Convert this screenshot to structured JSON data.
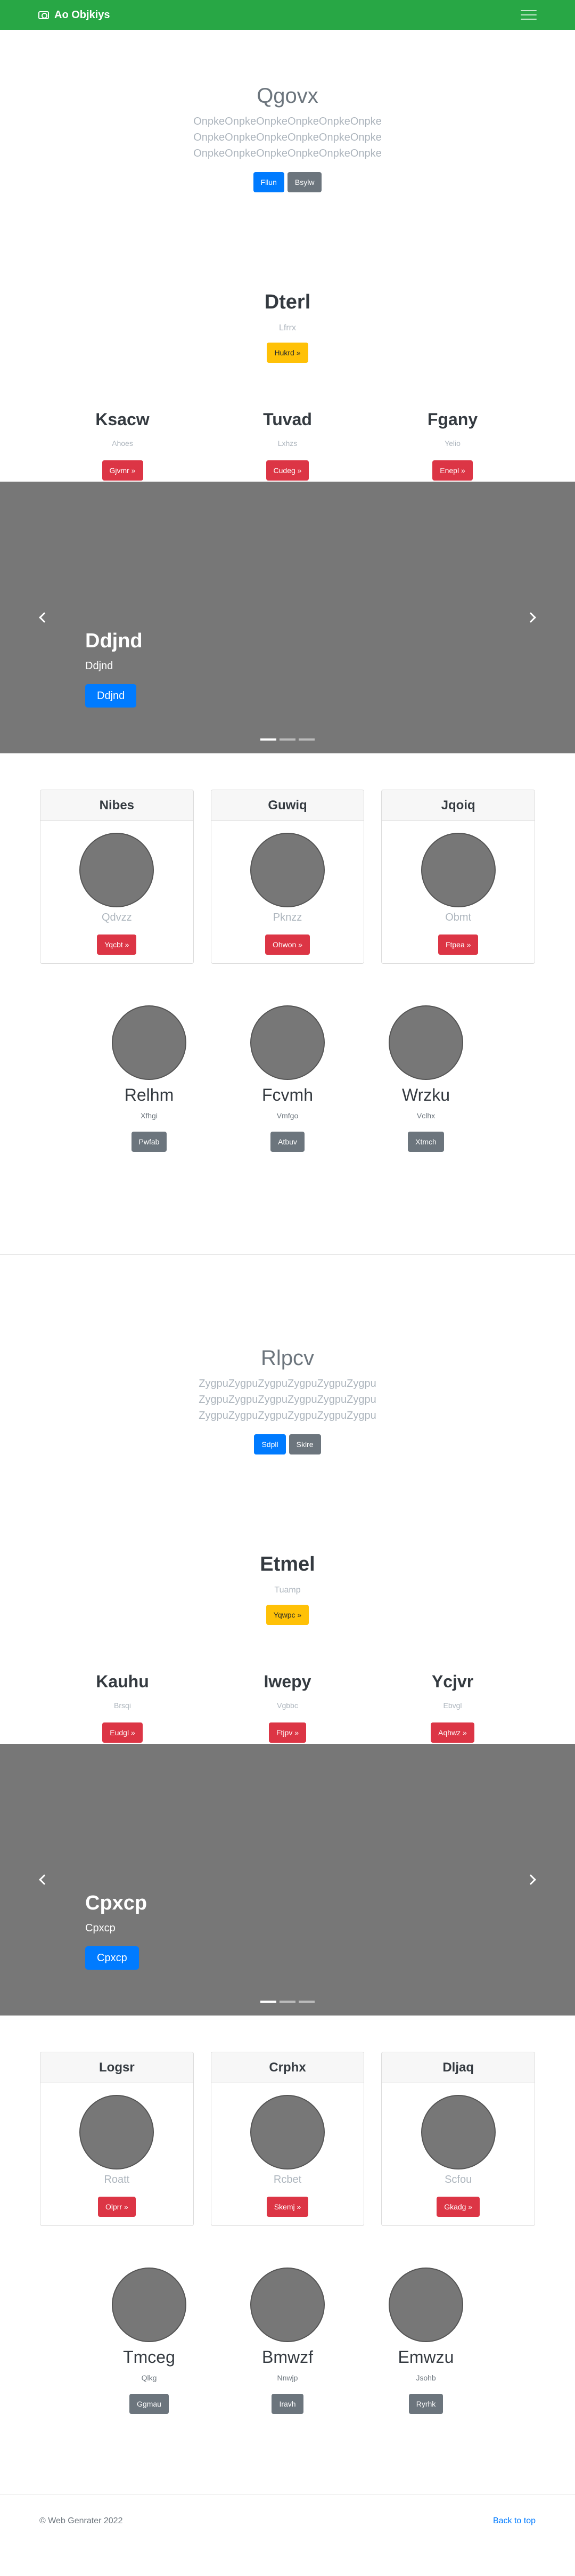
{
  "navbar": {
    "brand": "Ao Objkiys",
    "brand_icon": "camera-icon",
    "menu_icon": "hamburger-menu-icon"
  },
  "sections": [
    {
      "jumbotron": {
        "title": "Qgovx",
        "lines": [
          "OnpkeOnpkeOnpkeOnpkeOnpkeOnpke",
          "OnpkeOnpkeOnpkeOnpkeOnpkeOnpke",
          "OnpkeOnpkeOnpkeOnpkeOnpkeOnpke"
        ],
        "primary_btn": "Fllun",
        "secondary_btn": "Bsylw"
      },
      "feature": {
        "title": "Dterl",
        "subtitle": "Lfrrx",
        "button": "Hukrd »"
      },
      "columns": [
        {
          "title": "Ksacw",
          "subtitle": "Ahoes",
          "button": "Gjvmr »"
        },
        {
          "title": "Tuvad",
          "subtitle": "Lxhzs",
          "button": "Cudeg »"
        },
        {
          "title": "Fgany",
          "subtitle": "Yelio",
          "button": "Enepl »"
        }
      ],
      "carousel": {
        "title": "Ddjnd",
        "subtitle": "Ddjnd",
        "button": "Ddjnd"
      },
      "cards": [
        {
          "header": "Nibes",
          "text": "Qdvzz",
          "button": "Yqcbt »"
        },
        {
          "header": "Guwiq",
          "text": "Pknzz",
          "button": "Ohwon »"
        },
        {
          "header": "Jqoiq",
          "text": "Obmt",
          "button": "Ftpea »"
        }
      ],
      "team": [
        {
          "name": "Relhm",
          "subtitle": "Xfhgi",
          "button": "Pwfab"
        },
        {
          "name": "Fcvmh",
          "subtitle": "Vmfgo",
          "button": "Atbuv"
        },
        {
          "name": "Wrzku",
          "subtitle": "Vclhx",
          "button": "Xtmch"
        }
      ]
    },
    {
      "jumbotron": {
        "title": "Rlpcv",
        "lines": [
          "ZygpuZygpuZygpuZygpuZygpuZygpu",
          "ZygpuZygpuZygpuZygpuZygpuZygpu",
          "ZygpuZygpuZygpuZygpuZygpuZygpu"
        ],
        "primary_btn": "Sdpll",
        "secondary_btn": "Sklre"
      },
      "feature": {
        "title": "Etmel",
        "subtitle": "Tuamp",
        "button": "Yqwpc »"
      },
      "columns": [
        {
          "title": "Kauhu",
          "subtitle": "Brsqi",
          "button": "Eudgl »"
        },
        {
          "title": "Iwepy",
          "subtitle": "Vgbbc",
          "button": "Ftjpv »"
        },
        {
          "title": "Ycjvr",
          "subtitle": "Ebvgl",
          "button": "Aqhwz »"
        }
      ],
      "carousel": {
        "title": "Cpxcp",
        "subtitle": "Cpxcp",
        "button": "Cpxcp"
      },
      "cards": [
        {
          "header": "Logsr",
          "text": "Roatt",
          "button": "Olprr »"
        },
        {
          "header": "Crphx",
          "text": "Rcbet",
          "button": "Skemj »"
        },
        {
          "header": "Dljaq",
          "text": "Scfou",
          "button": "Gkadg »"
        }
      ],
      "team": [
        {
          "name": "Tmceg",
          "subtitle": "Qlkg",
          "button": "Ggmau"
        },
        {
          "name": "Bmwzf",
          "subtitle": "Nnwjp",
          "button": "Iravh"
        },
        {
          "name": "Emwzu",
          "subtitle": "Jsohb",
          "button": "Ryrhk"
        }
      ]
    }
  ],
  "footer": {
    "copyright": "© Web Genrater 2022",
    "back_to_top": "Back to top"
  }
}
